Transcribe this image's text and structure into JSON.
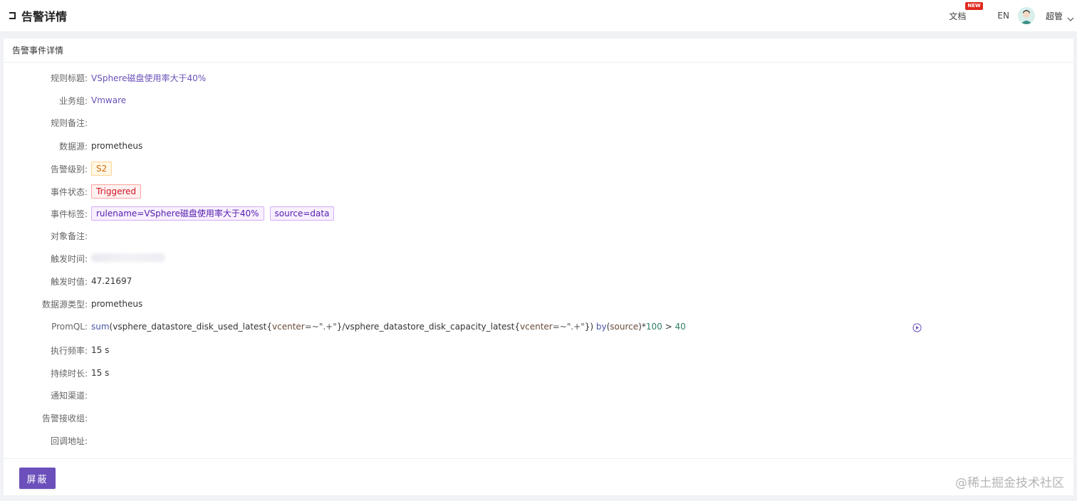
{
  "header": {
    "title": "告警详情",
    "docs_label": "文档",
    "new_badge": "NEW",
    "lang_label": "EN",
    "user_name": "超管"
  },
  "card": {
    "title": "告警事件详情"
  },
  "fields": {
    "rule_title": {
      "label": "规则标题:",
      "value": "VSphere磁盘使用率大于40%"
    },
    "business_group": {
      "label": "业务组:",
      "value": "Vmware"
    },
    "rule_note": {
      "label": "规则备注:",
      "value": ""
    },
    "datasource": {
      "label": "数据源:",
      "value": "prometheus"
    },
    "severity": {
      "label": "告警级别:",
      "value": "S2"
    },
    "event_status": {
      "label": "事件状态:",
      "value": "Triggered"
    },
    "event_tags": {
      "label": "事件标签:",
      "values": [
        "rulename=VSphere磁盘使用率大于40%",
        "source=data"
      ]
    },
    "target_note": {
      "label": "对象备注:",
      "value": ""
    },
    "trigger_time": {
      "label": "触发时间:"
    },
    "trigger_value": {
      "label": "触发时值:",
      "value": "47.21697"
    },
    "datasource_type": {
      "label": "数据源类型:",
      "value": "prometheus"
    },
    "promql": {
      "label": "PromQL:",
      "parts": {
        "p1": "sum",
        "p2": "(vsphere_datastore_disk_used_latest{",
        "p3": "vcenter",
        "p4": "=~\".+\"",
        "p5": "}/vsphere_datastore_disk_capacity_latest{",
        "p6": "vcenter",
        "p7": "=~\".+\"",
        "p8": "}) ",
        "p9": "by",
        "p10": "(",
        "p11": "source",
        "p12": ")*",
        "p13": "100",
        "p14": " > ",
        "p15": "40"
      }
    },
    "exec_frequency": {
      "label": "执行频率:",
      "value": "15 s"
    },
    "duration": {
      "label": "持续时长:",
      "value": "15 s"
    },
    "notify_channels": {
      "label": "通知渠道:",
      "value": ""
    },
    "receiver_groups": {
      "label": "告警接收组:",
      "value": ""
    },
    "callback_url": {
      "label": "回调地址:",
      "value": ""
    }
  },
  "footer": {
    "mute_label": "屏蔽"
  },
  "watermark": "@稀土掘金技术社区"
}
